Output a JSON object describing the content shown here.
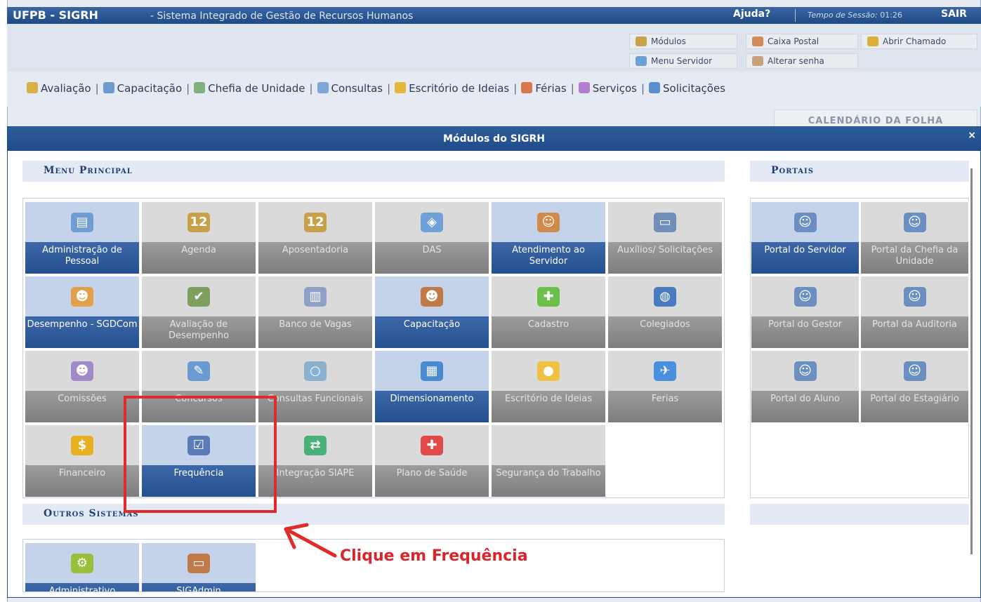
{
  "topbar": {
    "brand": "UFPB - SIGRH",
    "subtitle": "- Sistema Integrado de Gestão de Recursos Humanos",
    "help": "Ajuda?",
    "session_label": "Tempo de Sessão:",
    "session_time": "01:26",
    "logout": "SAIR"
  },
  "quick": {
    "modulos": "Módulos",
    "caixa_postal": "Caixa Postal",
    "abrir_chamado": "Abrir Chamado",
    "menu_servidor": "Menu Servidor",
    "alterar_senha": "Alterar senha"
  },
  "menubar": [
    {
      "label": "Avaliação"
    },
    {
      "label": "Capacitação"
    },
    {
      "label": "Chefia de Unidade"
    },
    {
      "label": "Consultas"
    },
    {
      "label": "Escritório de Ideias"
    },
    {
      "label": "Férias"
    },
    {
      "label": "Serviços"
    },
    {
      "label": "Solicitações"
    }
  ],
  "calendar_button": "Calendário da Folha",
  "modal": {
    "title": "Módulos do SIGRH",
    "close": "×",
    "menu_principal": "Menu Principal",
    "portais": "Portais",
    "outros_sistemas": "Outros Sistemas"
  },
  "modules": [
    {
      "label": "Administração de Pessoal",
      "active": true
    },
    {
      "label": "Agenda",
      "active": false
    },
    {
      "label": "Aposentadoria",
      "active": false
    },
    {
      "label": "DAS",
      "active": false
    },
    {
      "label": "Atendimento ao Servidor",
      "active": true
    },
    {
      "label": "Auxílios/ Solicitações",
      "active": false
    },
    {
      "label": "Desempenho - SGDCom",
      "active": true
    },
    {
      "label": "Avaliação de Desempenho",
      "active": false
    },
    {
      "label": "Banco de Vagas",
      "active": false
    },
    {
      "label": "Capacitação",
      "active": true
    },
    {
      "label": "Cadastro",
      "active": false
    },
    {
      "label": "Colegiados",
      "active": false
    },
    {
      "label": "Comissões",
      "active": false
    },
    {
      "label": "Concursos",
      "active": false
    },
    {
      "label": "Consultas Funcionais",
      "active": false
    },
    {
      "label": "Dimensionamento",
      "active": true
    },
    {
      "label": "Escritório de Ideias",
      "active": false
    },
    {
      "label": "Ferias",
      "active": false
    },
    {
      "label": "Financeiro",
      "active": false
    },
    {
      "label": "Frequência",
      "active": true
    },
    {
      "label": "Integração SIAPE",
      "active": false
    },
    {
      "label": "Plano de Saúde",
      "active": false
    },
    {
      "label": "Segurança do Trabalho",
      "active": false
    }
  ],
  "portals": [
    {
      "label": "Portal do Servidor",
      "active": true
    },
    {
      "label": "Portal da Chefia da Unidade",
      "active": false
    },
    {
      "label": "Portal do Gestor",
      "active": false
    },
    {
      "label": "Portal da Auditoria",
      "active": false
    },
    {
      "label": "Portal do Aluno",
      "active": false
    },
    {
      "label": "Portal do Estagiário",
      "active": false
    }
  ],
  "other_systems": [
    {
      "label": "Administrativo",
      "active": true
    },
    {
      "label": "SIGAdmin",
      "active": true
    }
  ],
  "annotation": "Clique em Frequência"
}
